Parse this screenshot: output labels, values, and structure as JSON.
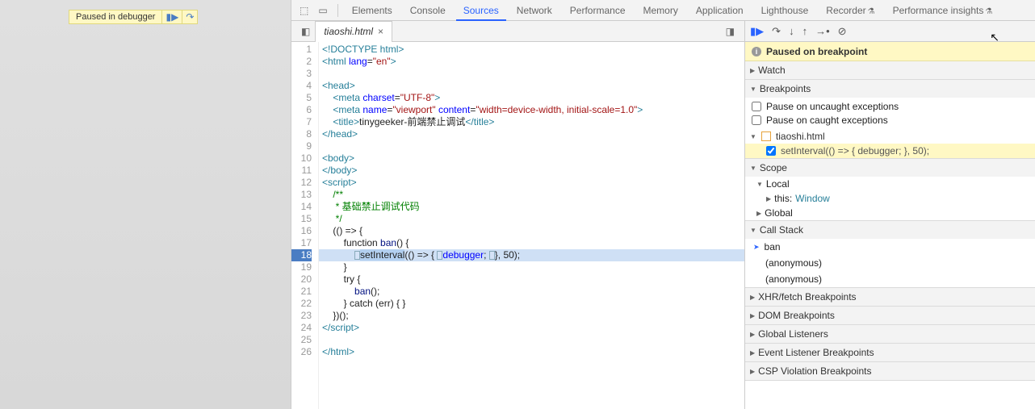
{
  "overlay": {
    "text": "Paused in debugger"
  },
  "tabs": {
    "elements": "Elements",
    "console": "Console",
    "sources": "Sources",
    "network": "Network",
    "performance": "Performance",
    "memory": "Memory",
    "application": "Application",
    "lighthouse": "Lighthouse",
    "recorder": "Recorder",
    "perf_insights": "Performance insights"
  },
  "file": {
    "name": "tiaoshi.html"
  },
  "code": {
    "l1": "<!DOCTYPE html>",
    "l2_a": "<html ",
    "l2_b": "lang",
    "l2_c": "=",
    "l2_d": "\"en\"",
    "l2_e": ">",
    "l3": "",
    "l4": "<head>",
    "l5_a": "    <meta ",
    "l5_b": "charset",
    "l5_c": "=",
    "l5_d": "\"UTF-8\"",
    "l5_e": ">",
    "l6_a": "    <meta ",
    "l6_b": "name",
    "l6_c": "=",
    "l6_d": "\"viewport\"",
    "l6_e": " ",
    "l6_f": "content",
    "l6_g": "=",
    "l6_h": "\"width=device-width, initial-scale=1.0\"",
    "l6_i": ">",
    "l7_a": "    <title>",
    "l7_b": "tinygeeker-前端禁止调试",
    "l7_c": "</title>",
    "l8": "</head>",
    "l9": "",
    "l10": "<body>",
    "l11": "</body>",
    "l12": "<script>",
    "l13": "    /**",
    "l14": "     * 基础禁止调试代码",
    "l15": "     */",
    "l16": "    (() => {",
    "l17_a": "        function ",
    "l17_b": "ban",
    "l17_c": "() {",
    "l18_a": "            ",
    "l18_b": "setInterval",
    "l18_c": "(() => { ",
    "l18_d": "D",
    "l18_e": "debugger",
    "l18_f": "; ",
    "l18_g": "D",
    "l18_h": "}, 50);",
    "l19": "        }",
    "l20": "        try {",
    "l21_a": "            ",
    "l21_b": "ban",
    "l21_c": "();",
    "l22": "        } catch (err) { }",
    "l23": "    })();",
    "l24": "</scr",
    "l24b": "ipt>",
    "l25": "",
    "l26": "</html>"
  },
  "banner": {
    "text": "Paused on breakpoint"
  },
  "sections": {
    "watch": "Watch",
    "breakpoints": "Breakpoints",
    "scope": "Scope",
    "callstack": "Call Stack",
    "xhr": "XHR/fetch Breakpoints",
    "dom": "DOM Breakpoints",
    "global_listeners": "Global Listeners",
    "event_listener": "Event Listener Breakpoints",
    "csp": "CSP Violation Breakpoints"
  },
  "breakpoints": {
    "uncaught": "Pause on uncaught exceptions",
    "caught": "Pause on caught exceptions",
    "file": "tiaoshi.html",
    "line": "setInterval(() => { debugger; }, 50);"
  },
  "scope": {
    "local": "Local",
    "this_label": "this: ",
    "this_val": "Window",
    "global": "Global"
  },
  "callstack": {
    "f0": "ban",
    "f1": "(anonymous)",
    "f2": "(anonymous)"
  }
}
